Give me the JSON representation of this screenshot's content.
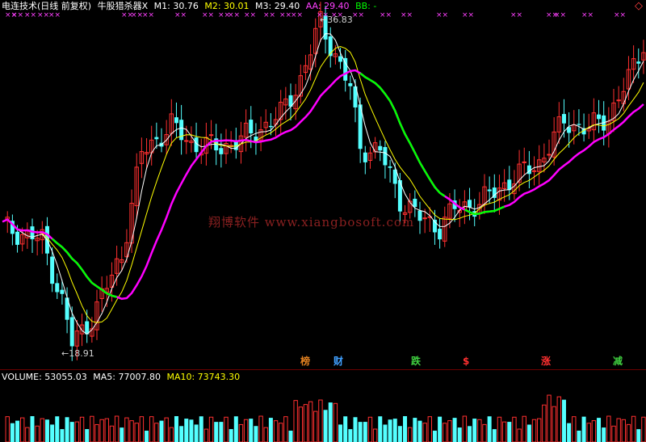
{
  "header": {
    "title": "电连技术(日线 前复权)",
    "indicator": "牛股猎杀器X",
    "m1": "M1: 30.76",
    "m2": "M2: 30.01",
    "m3": "M3: 29.40",
    "aa": "AA: 29.40",
    "bb": "BB: -"
  },
  "volume_header": {
    "volume": "VOLUME: 53055.03",
    "ma5": "MA5: 77007.80",
    "ma10": "MA10: 73743.30"
  },
  "labels": {
    "high": "36.83",
    "low": "18.91",
    "watermark": "翔博软件 www.xiangbosoft.com"
  },
  "events": [
    {
      "text": "榜",
      "color": "#e08020"
    },
    {
      "text": "财",
      "color": "#40a0ff"
    },
    {
      "text": "跌",
      "color": "#40d040"
    },
    {
      "text": "$",
      "color": "#ff3030"
    },
    {
      "text": "涨",
      "color": "#ff3030"
    },
    {
      "text": "减",
      "color": "#40d040"
    }
  ],
  "colors": {
    "up": "#ff3030",
    "down": "#54ffff",
    "m1": "#ffffff",
    "m2": "#ffff00",
    "ma_main": "#ff00ff",
    "ma_green": "#00ff00",
    "cross": "#ff40ff",
    "title": "#ffffff",
    "m2_color": "#ffff00",
    "aa_color": "#ff40ff",
    "bb_color": "#00ff00"
  }
}
